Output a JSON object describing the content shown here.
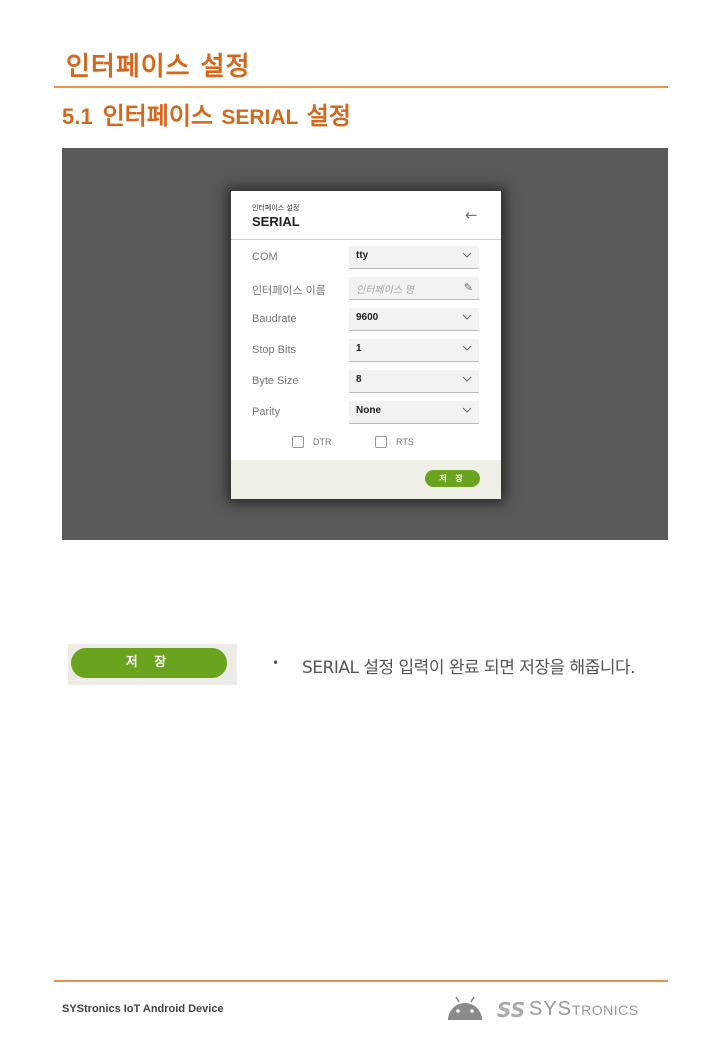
{
  "header": {
    "title": "인터페이스 설정",
    "section_number": "5.1",
    "section_title_ko": "인터페이스",
    "section_title_en": "SERIAL",
    "section_title_suffix": "설정"
  },
  "dialog": {
    "subtitle": "인터페이스 설정",
    "title": "SERIAL",
    "back_icon": "arrow-left-icon",
    "rows": [
      {
        "label": "COM",
        "value": "tty",
        "type": "select"
      },
      {
        "label": "인터페이스 이름",
        "placeholder": "인터페이스 명",
        "type": "text"
      },
      {
        "label": "Baudrate",
        "value": "9600",
        "type": "select"
      },
      {
        "label": "Stop Bits",
        "value": "1",
        "type": "select"
      },
      {
        "label": "Byte Size",
        "value": "8",
        "type": "select"
      },
      {
        "label": "Parity",
        "value": "None",
        "type": "select"
      }
    ],
    "checkboxes": [
      {
        "label": "DTR",
        "checked": false
      },
      {
        "label": "RTS",
        "checked": false
      }
    ],
    "save_label": "저 장"
  },
  "description": {
    "button_label": "저 장",
    "bullet": "•",
    "text": "SERIAL 설정 입력이 완료 되면 저장을 해줍니다."
  },
  "footer": {
    "text": "SYStronics IoT Android Device",
    "logo_mark": "SS",
    "logo_sys": "SYS",
    "logo_tronics": "TRONICS"
  },
  "colors": {
    "heading": "#d2691e",
    "rule": "#e8944c",
    "save_green": "#6aa31e",
    "screenshot_bg": "#595959"
  }
}
